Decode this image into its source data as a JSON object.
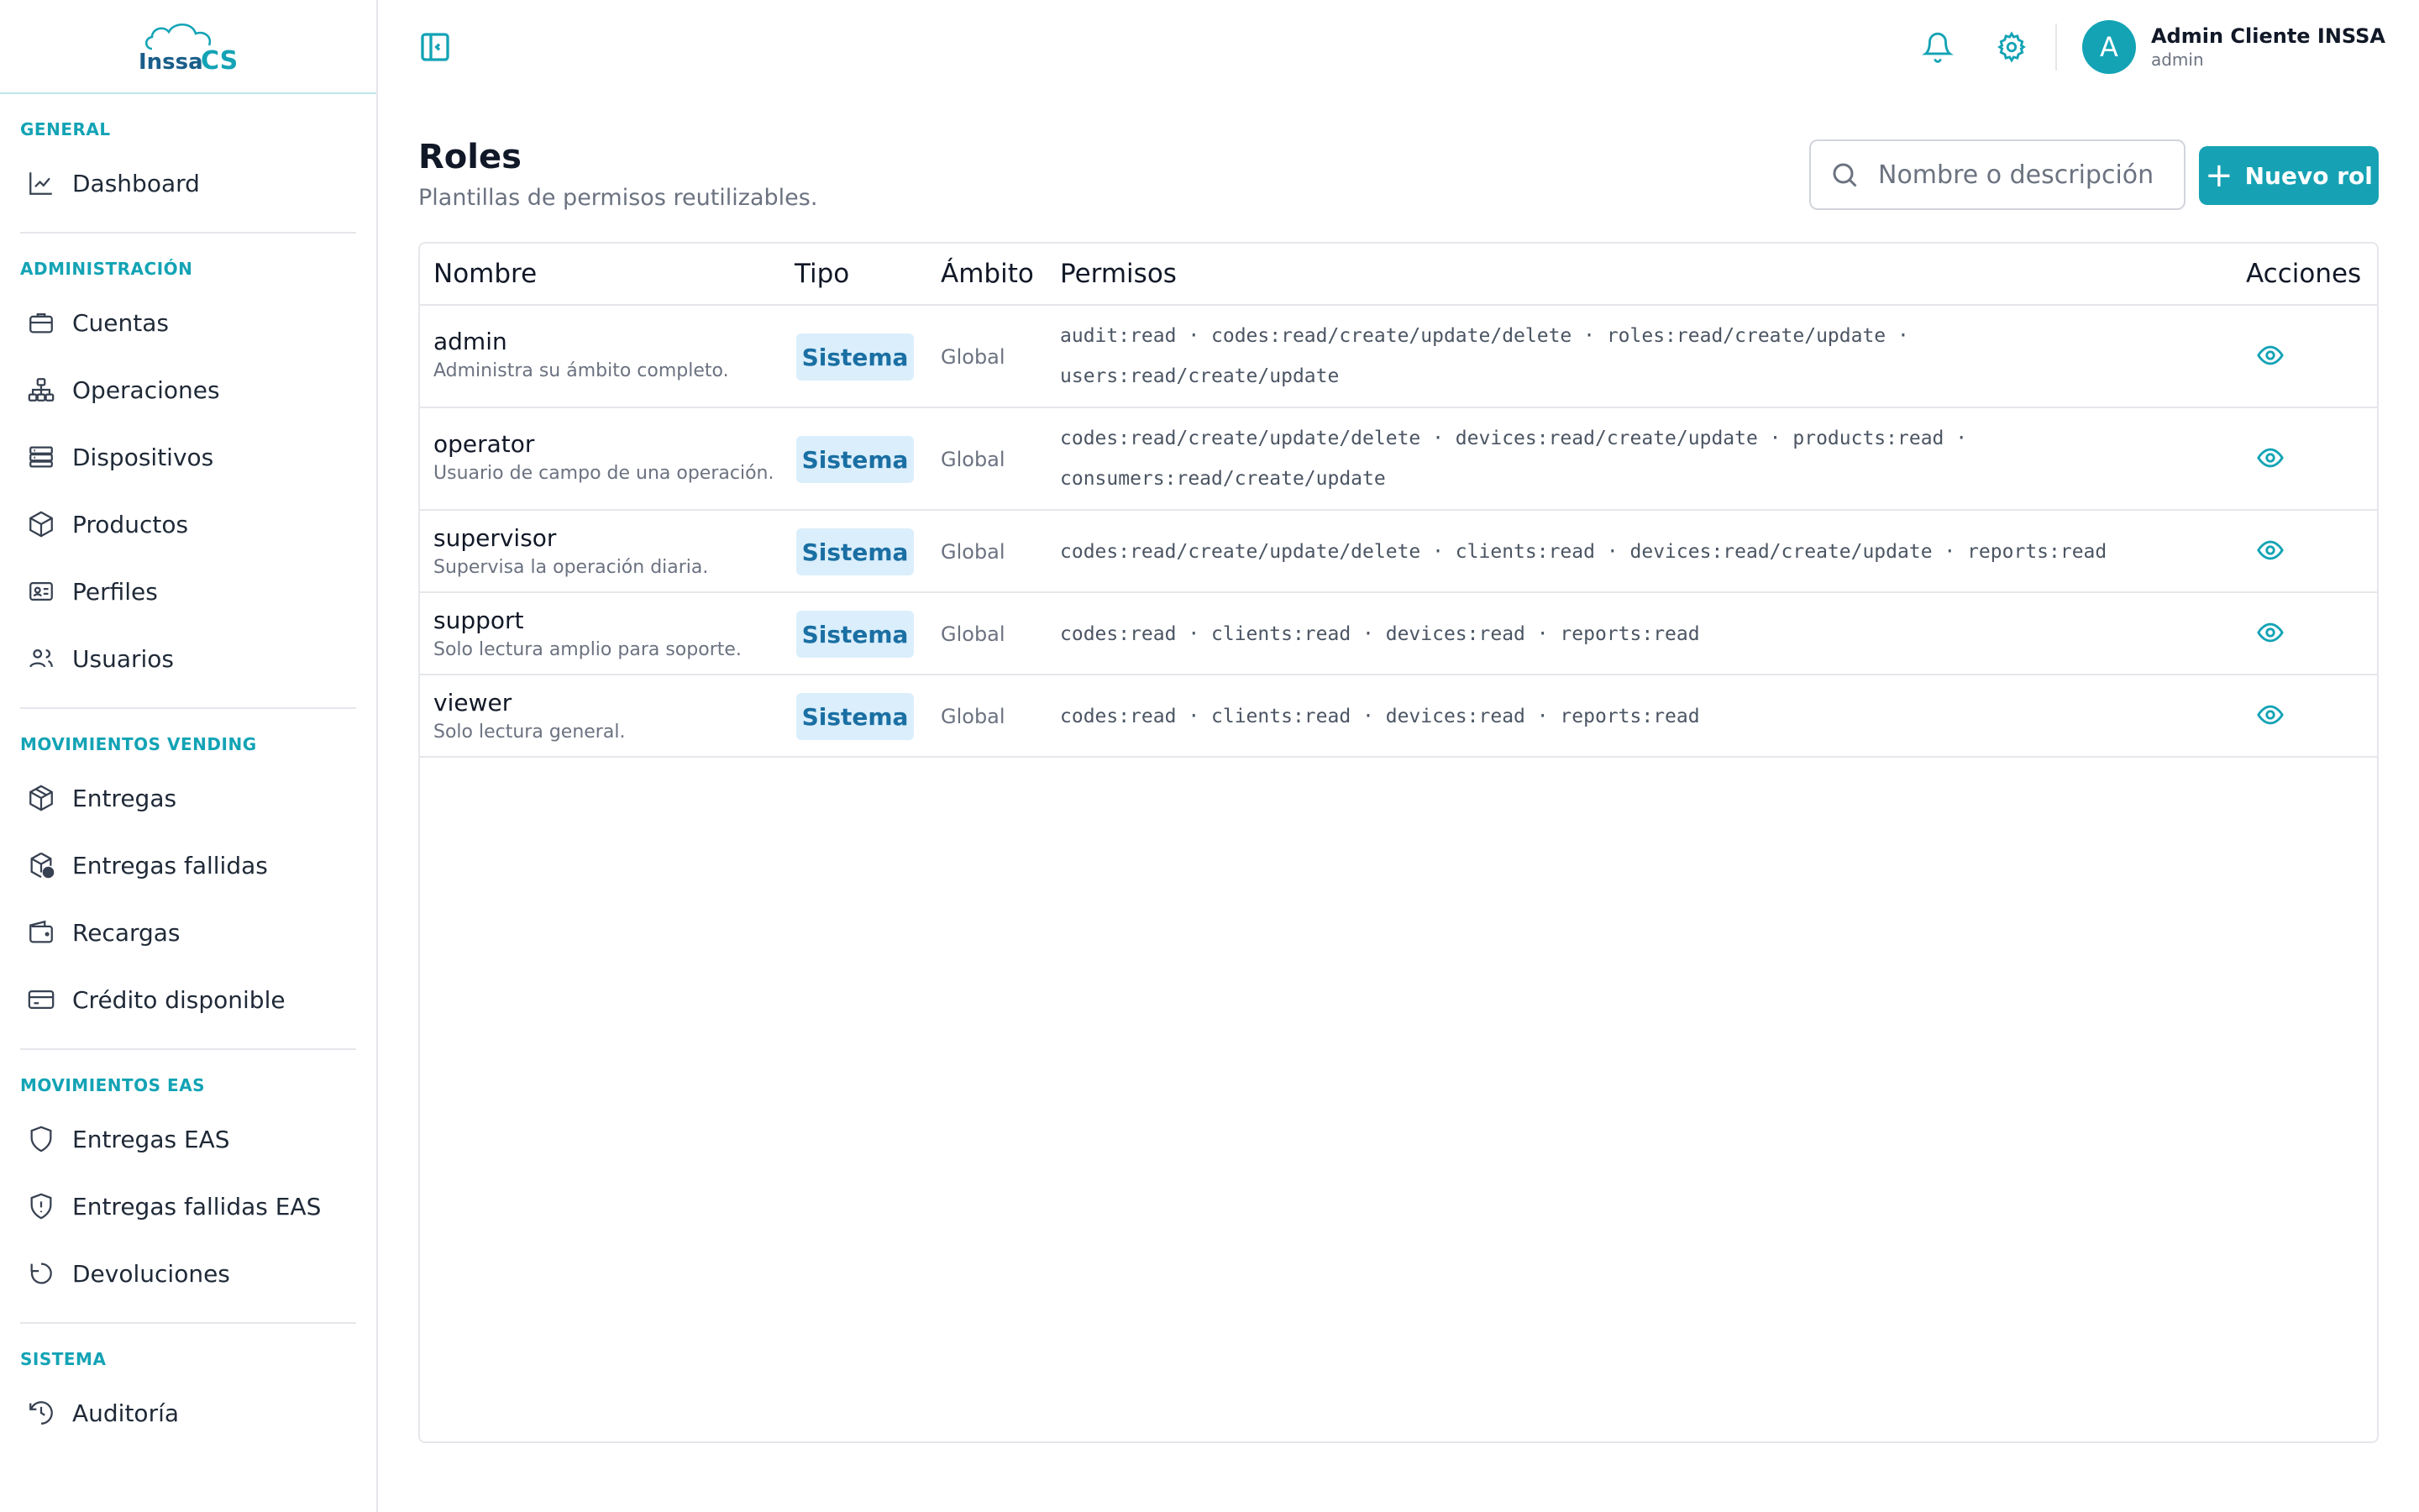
{
  "app": {
    "logo_text": "INSSA CS",
    "accent": "#16a2b4"
  },
  "sidebar": {
    "sections": [
      {
        "title": "GENERAL",
        "items": [
          {
            "label": "Dashboard",
            "icon": "chart-line-icon"
          }
        ]
      },
      {
        "title": "ADMINISTRACIÓN",
        "items": [
          {
            "label": "Cuentas",
            "icon": "briefcase-icon"
          },
          {
            "label": "Operaciones",
            "icon": "network-icon"
          },
          {
            "label": "Dispositivos",
            "icon": "server-icon"
          },
          {
            "label": "Productos",
            "icon": "box-icon"
          },
          {
            "label": "Perfiles",
            "icon": "id-card-icon"
          },
          {
            "label": "Usuarios",
            "icon": "users-icon"
          }
        ]
      },
      {
        "title": "MOVIMIENTOS VENDING",
        "items": [
          {
            "label": "Entregas",
            "icon": "package-icon"
          },
          {
            "label": "Entregas fallidas",
            "icon": "package-alert-icon"
          },
          {
            "label": "Recargas",
            "icon": "wallet-icon"
          },
          {
            "label": "Crédito disponible",
            "icon": "credit-card-icon"
          }
        ]
      },
      {
        "title": "MOVIMIENTOS EAS",
        "items": [
          {
            "label": "Entregas EAS",
            "icon": "shield-icon"
          },
          {
            "label": "Entregas fallidas EAS",
            "icon": "shield-alert-icon"
          },
          {
            "label": "Devoluciones",
            "icon": "undo-icon"
          }
        ]
      },
      {
        "title": "SISTEMA",
        "items": [
          {
            "label": "Auditoría",
            "icon": "history-icon"
          }
        ]
      }
    ]
  },
  "topbar": {
    "user": {
      "initial": "A",
      "name": "Admin Cliente INSSA",
      "role": "admin"
    }
  },
  "main": {
    "title": "Roles",
    "subtitle": "Plantillas de permisos reutilizables.",
    "search": {
      "placeholder": "Nombre o descripción",
      "value": ""
    },
    "new_button": "Nuevo rol",
    "table": {
      "headers": {
        "name": "Nombre",
        "type": "Tipo",
        "scope": "Ámbito",
        "permissions": "Permisos",
        "actions": "Acciones"
      },
      "rows": [
        {
          "name": "admin",
          "description": "Administra su ámbito completo.",
          "type": "Sistema",
          "scope": "Global",
          "permissions": "audit:read · codes:read/create/update/delete · roles:read/create/update · users:read/create/update"
        },
        {
          "name": "operator",
          "description": "Usuario de campo de una operación.",
          "type": "Sistema",
          "scope": "Global",
          "permissions": "codes:read/create/update/delete · devices:read/create/update · products:read · consumers:read/create/update"
        },
        {
          "name": "supervisor",
          "description": "Supervisa la operación diaria.",
          "type": "Sistema",
          "scope": "Global",
          "permissions": "codes:read/create/update/delete · clients:read · devices:read/create/update · reports:read"
        },
        {
          "name": "support",
          "description": "Solo lectura amplio para soporte.",
          "type": "Sistema",
          "scope": "Global",
          "permissions": "codes:read · clients:read · devices:read · reports:read"
        },
        {
          "name": "viewer",
          "description": "Solo lectura general.",
          "type": "Sistema",
          "scope": "Global",
          "permissions": "codes:read · clients:read · devices:read · reports:read"
        }
      ]
    }
  }
}
